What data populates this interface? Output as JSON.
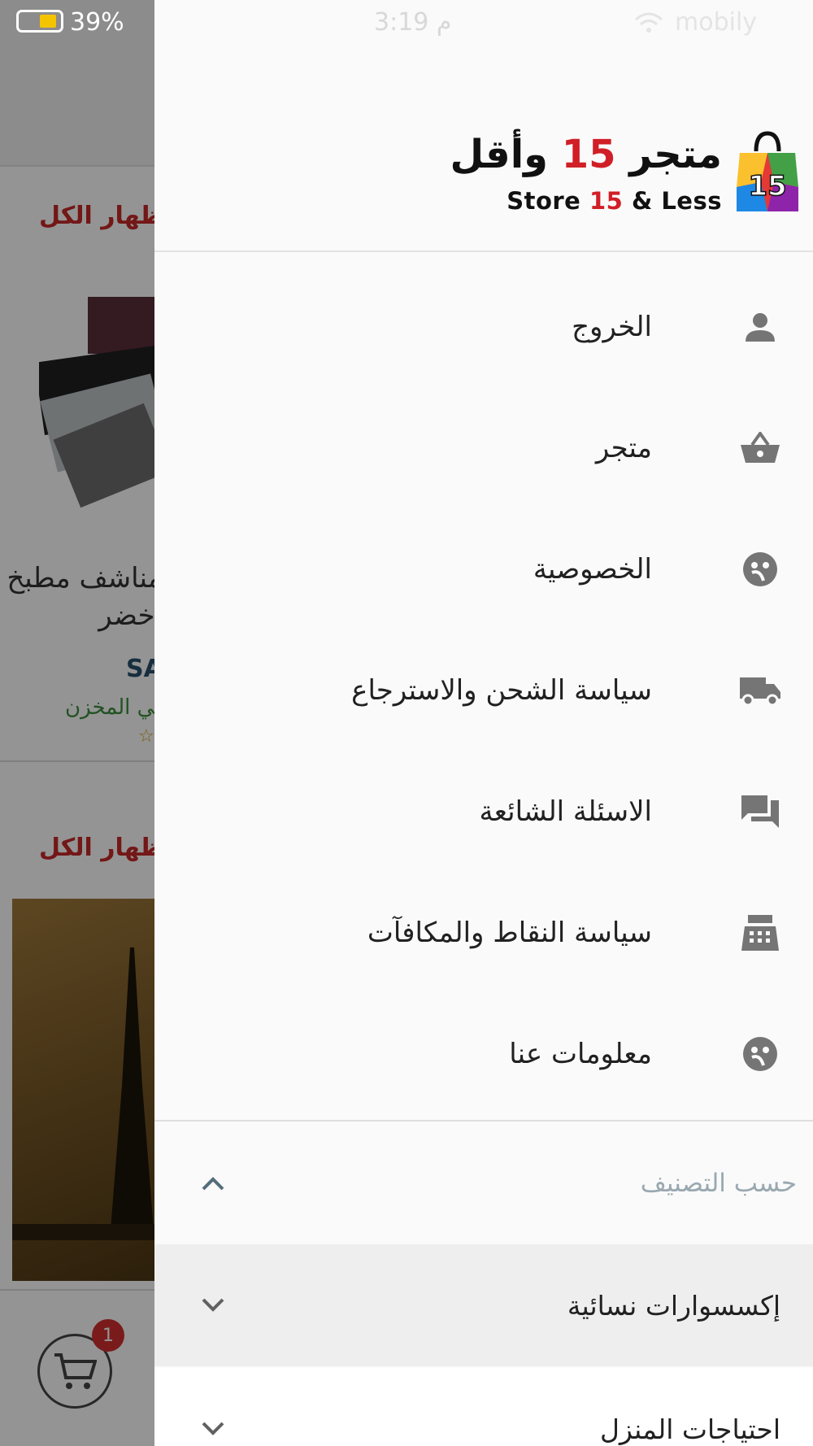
{
  "status_bar": {
    "battery": "39%",
    "time": "3:19 م",
    "carrier": "mobily"
  },
  "background": {
    "show_all_1": "إظهار الكل",
    "show_all_2": "إظهار الكل",
    "product_title_line1": "مناشف مطبخ عدد",
    "product_title_line2": "أخضر",
    "product_price": "SAR",
    "product_stock": "متوفر في المخزن",
    "cart_badge": "1"
  },
  "drawer": {
    "logo_ar_prefix": "متجر",
    "logo_ar_number": "15",
    "logo_ar_suffix": "وأقل",
    "logo_en_prefix": "Store",
    "logo_en_number": "15",
    "logo_en_suffix": "& Less",
    "menu": [
      {
        "label": "الخروج",
        "icon": "person-icon"
      },
      {
        "label": "متجر",
        "icon": "basket-icon"
      },
      {
        "label": "الخصوصية",
        "icon": "face-icon"
      },
      {
        "label": "سياسة الشحن والاسترجاع",
        "icon": "truck-icon"
      },
      {
        "label": "الاسئلة الشائعة",
        "icon": "chat-icon"
      },
      {
        "label": "سياسة النقاط والمكافآت",
        "icon": "register-icon"
      },
      {
        "label": "معلومات عنا",
        "icon": "face-icon"
      }
    ],
    "section_title": "حسب التصنيف",
    "categories": [
      {
        "label": "إكسسوارات نسائية"
      },
      {
        "label": "احتياجات المنزل"
      }
    ]
  },
  "colors": {
    "accent_red": "#d01f26",
    "icon_gray": "#757575",
    "section_gray": "#9aa8b0"
  }
}
